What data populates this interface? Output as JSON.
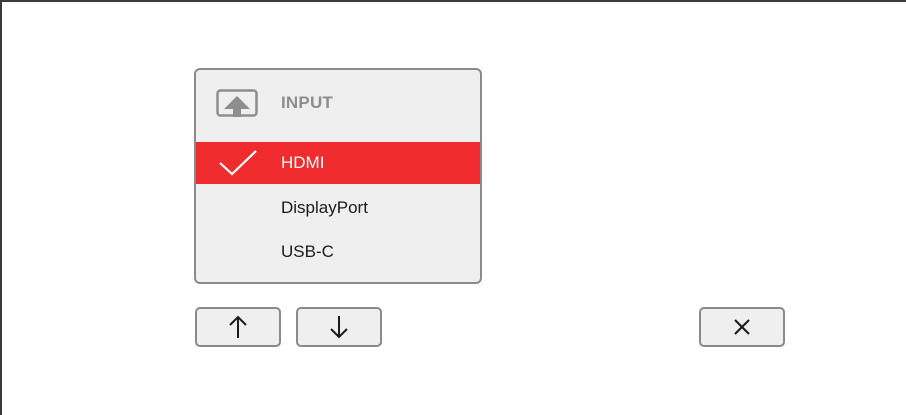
{
  "menu": {
    "icon": "input-source-icon",
    "title": "INPUT",
    "items": [
      {
        "label": "HDMI",
        "selected": true
      },
      {
        "label": "DisplayPort",
        "selected": false
      },
      {
        "label": "USB-C",
        "selected": false
      }
    ]
  },
  "buttons": {
    "up_icon": "arrow-up-icon",
    "down_icon": "arrow-down-icon",
    "close_icon": "close-icon"
  },
  "colors": {
    "selection": "#ef2b2e",
    "panel_background": "#efefef",
    "header_text": "#8e8e8e",
    "border": "#8a8a8a"
  }
}
